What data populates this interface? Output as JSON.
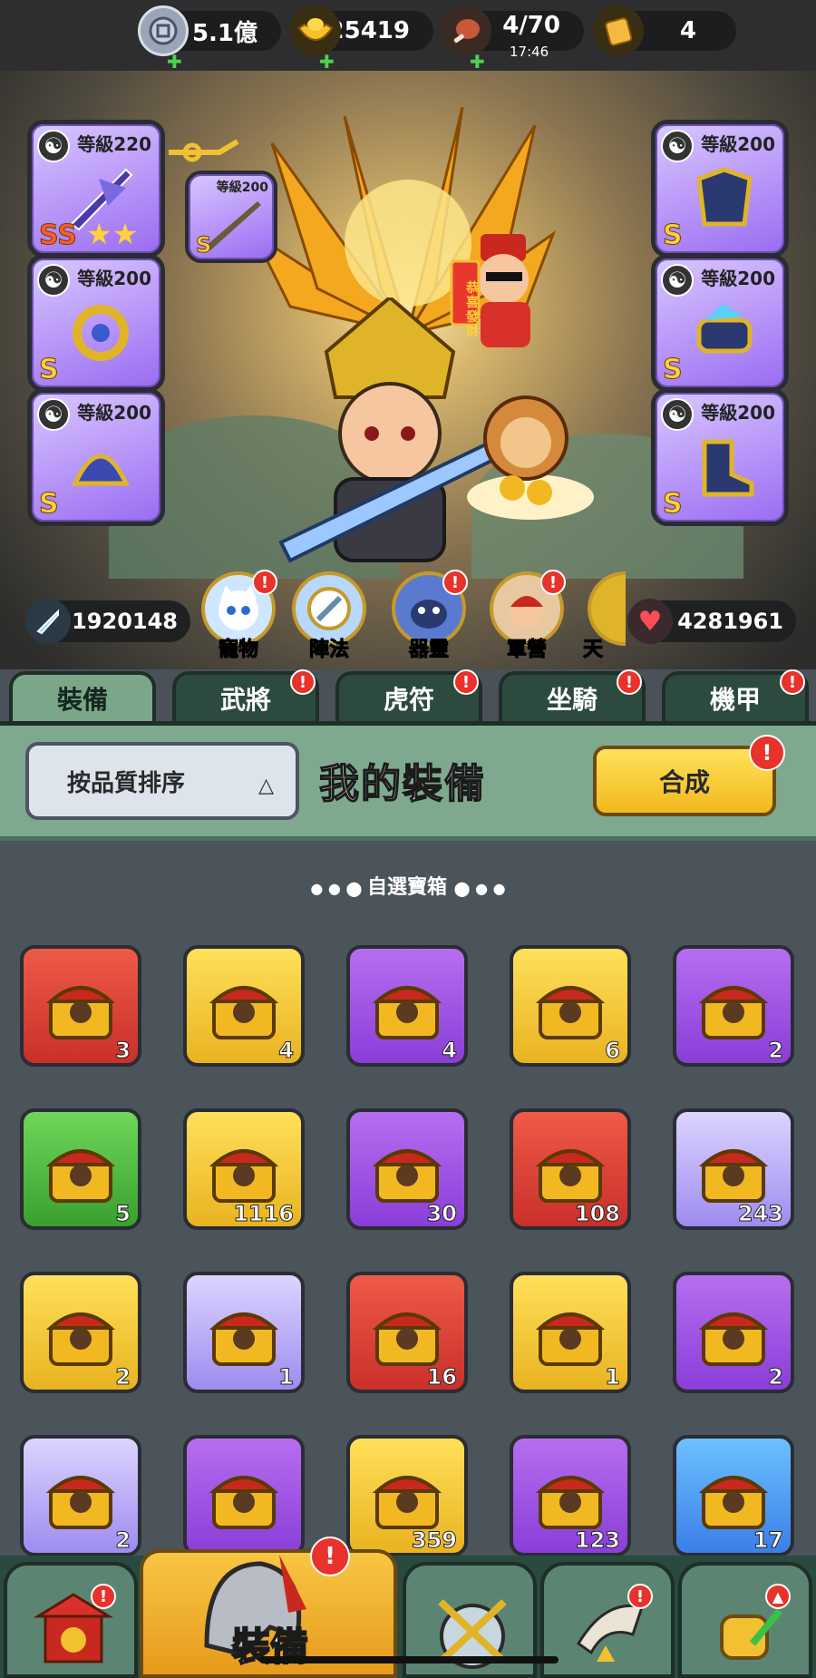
{
  "resources": [
    {
      "icon": "coin-icon",
      "value": "5.1億"
    },
    {
      "icon": "gold-ingot-icon",
      "value": "25419"
    },
    {
      "icon": "meat-icon",
      "value": "4/70",
      "sub": "17:46"
    },
    {
      "icon": "scroll-icon",
      "value": "4"
    }
  ],
  "equipment_left": [
    {
      "level": "等級220",
      "grade": "SS",
      "stars": 2
    },
    {
      "level": "等級200",
      "grade": "S"
    },
    {
      "level": "等級200",
      "grade": "S"
    }
  ],
  "equipment_linked": {
    "level": "等級200",
    "grade": "S"
  },
  "equipment_right": [
    {
      "level": "等級200",
      "grade": "S"
    },
    {
      "level": "等級200",
      "grade": "S"
    },
    {
      "level": "等級200",
      "grade": "S"
    }
  ],
  "banner_text": "恭喜發財",
  "stats": {
    "attack": "1920148",
    "hp": "4281961"
  },
  "feature_menu": [
    {
      "label": "寵物",
      "badge": "!"
    },
    {
      "label": "陣法",
      "badge": ""
    },
    {
      "label": "器靈",
      "badge": "!"
    },
    {
      "label": "軍營",
      "badge": "!"
    },
    {
      "label": "天",
      "badge": ""
    }
  ],
  "tabs": [
    {
      "label": "裝備",
      "active": true,
      "badge": ""
    },
    {
      "label": "武將",
      "badge": "!"
    },
    {
      "label": "虎符",
      "badge": "!"
    },
    {
      "label": "坐騎",
      "badge": "!"
    },
    {
      "label": "機甲",
      "badge": "!"
    }
  ],
  "panel": {
    "sort_label": "按品質排序",
    "sort_arrow": "△",
    "title": "我的裝備",
    "combine_label": "合成",
    "combine_badge": "!"
  },
  "section_title": "自選寶箱",
  "items": [
    {
      "color": "red",
      "count": "3",
      "icon": "red-envelope-chest-icon"
    },
    {
      "color": "gold",
      "count": "4",
      "icon": "sword-chest-icon"
    },
    {
      "color": "purple",
      "count": "4",
      "icon": "treasure-chest-icon"
    },
    {
      "color": "gold",
      "count": "6",
      "icon": "treasure-chest-icon"
    },
    {
      "color": "purple",
      "count": "2",
      "icon": "puzzle-chest-icon"
    },
    {
      "color": "green",
      "count": "5",
      "icon": "equipment-chest-icon"
    },
    {
      "color": "gold",
      "count": "1116",
      "icon": "mystery-hero-chest-icon"
    },
    {
      "color": "purple",
      "count": "30",
      "icon": "mystery-hero-chest-icon"
    },
    {
      "color": "red",
      "count": "108",
      "icon": "hero-shard-icon"
    },
    {
      "color": "light",
      "count": "243",
      "icon": "hero-shard-icon"
    },
    {
      "color": "gold",
      "count": "2",
      "icon": "hero-portrait-chest-icon"
    },
    {
      "color": "light",
      "count": "1",
      "icon": "hero-portrait-chest-icon"
    },
    {
      "color": "red",
      "count": "16",
      "icon": "mystery-puzzle-icon"
    },
    {
      "color": "gold",
      "count": "1",
      "icon": "lucky-bag-icon"
    },
    {
      "color": "purple",
      "count": "2",
      "icon": "lion-chest-icon"
    },
    {
      "color": "light",
      "count": "2",
      "icon": "egg-icon"
    },
    {
      "color": "purple",
      "count": "",
      "icon": "crown-chest-icon"
    },
    {
      "color": "gold",
      "count": "359",
      "icon": "mystery-hero-chest-icon"
    },
    {
      "color": "purple",
      "count": "123",
      "icon": "mystery-hero-chest-icon"
    },
    {
      "color": "blue",
      "count": "17",
      "icon": "mystery-hero-chest-icon"
    }
  ],
  "bottom_nav": [
    {
      "icon": "shop-icon",
      "badge": "!"
    },
    {
      "icon": "helmet-icon",
      "label": "裝備",
      "active": true,
      "badge": "!"
    },
    {
      "icon": "battle-icon",
      "badge": ""
    },
    {
      "icon": "hero-horn-icon",
      "badge": "!"
    },
    {
      "icon": "upgrade-fist-icon",
      "badge": "up"
    }
  ],
  "colors": {
    "tab_active": "#7aa68a",
    "tab_inactive": "#2d4a3e",
    "panel": "#7fa98e",
    "grid_bg": "#4b535b",
    "badge": "#e8322b",
    "combine": "#f6c52f"
  }
}
